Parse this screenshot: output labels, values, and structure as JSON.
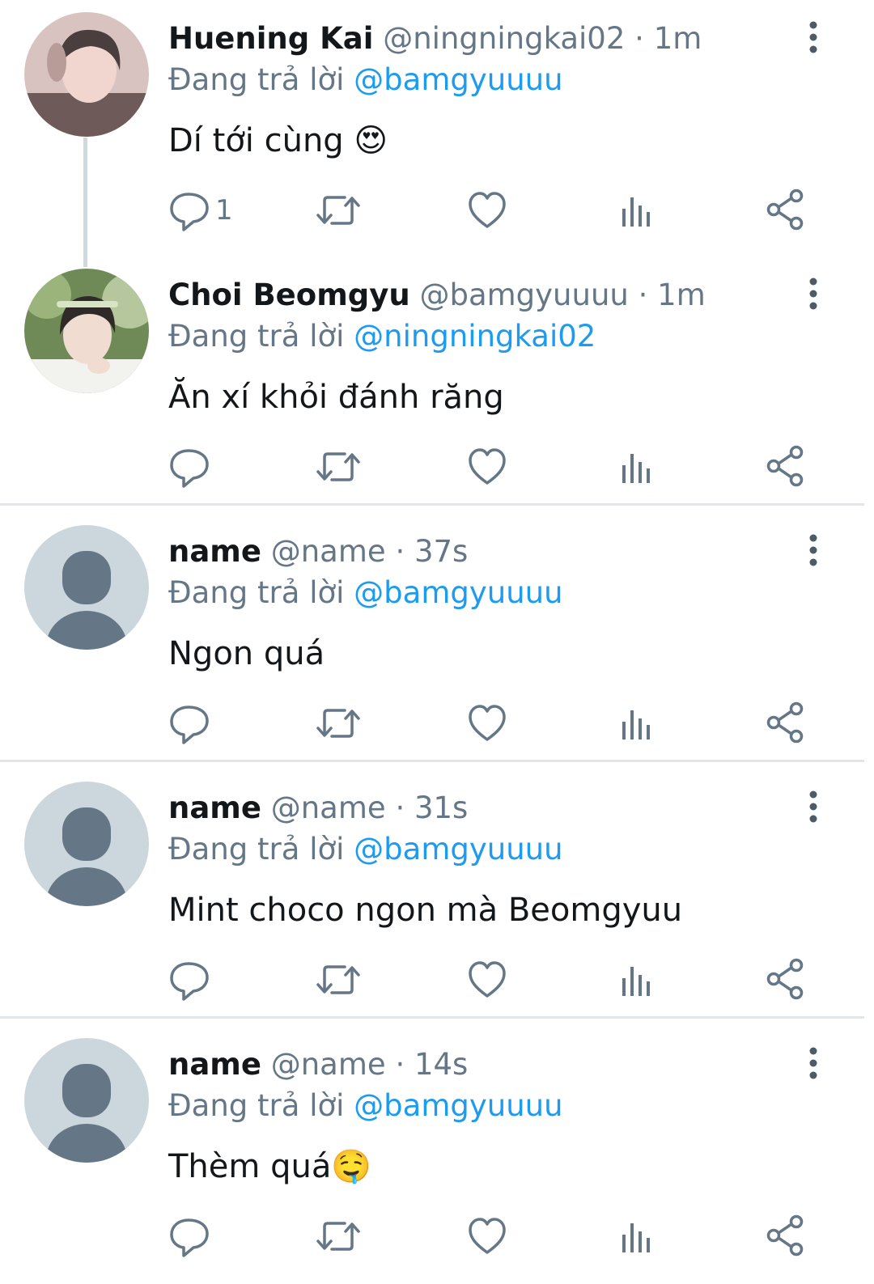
{
  "tweets": [
    {
      "name": "Huening Kai",
      "handle": "@ningningkai02",
      "separator": "·",
      "time": "1m",
      "reply_prefix": "Đang trả lời",
      "reply_to": "@bamgyuuuu",
      "text": "Dí tới cùng 😍",
      "reply_count": "1",
      "avatar": "photo"
    },
    {
      "name": "Choi Beomgyu",
      "handle": "@bamgyuuuu",
      "separator": "·",
      "time": "1m",
      "reply_prefix": "Đang trả lời",
      "reply_to": "@ningningkai02",
      "text": "Ăn xí khỏi đánh răng",
      "reply_count": "",
      "avatar": "photo"
    },
    {
      "name": "name",
      "handle": "@name",
      "separator": "·",
      "time": "37s",
      "reply_prefix": "Đang trả lời",
      "reply_to": "@bamgyuuuu",
      "text": "Ngon quá",
      "reply_count": "",
      "avatar": "default"
    },
    {
      "name": "name",
      "handle": "@name",
      "separator": "·",
      "time": "31s",
      "reply_prefix": "Đang trả lời",
      "reply_to": "@bamgyuuuu",
      "text": "Mint choco ngon mà Beomgyuu",
      "reply_count": "",
      "avatar": "default"
    },
    {
      "name": "name",
      "handle": "@name",
      "separator": "·",
      "time": "14s",
      "reply_prefix": "Đang trả lời",
      "reply_to": "@bamgyuuuu",
      "text": "Thèm quá🤤",
      "reply_count": "",
      "avatar": "default"
    }
  ],
  "icons": {
    "reply": "reply-icon",
    "retweet": "retweet-icon",
    "like": "heart-icon",
    "analytics": "analytics-icon",
    "share": "share-icon",
    "menu": "more-vertical-icon"
  },
  "colors": {
    "mention": "#1d9bf0",
    "secondary_text": "#657786",
    "icon": "#657786",
    "divider": "#e3e6e8",
    "default_avatar_bg": "#ccd6dd",
    "default_avatar_fg": "#657786"
  }
}
